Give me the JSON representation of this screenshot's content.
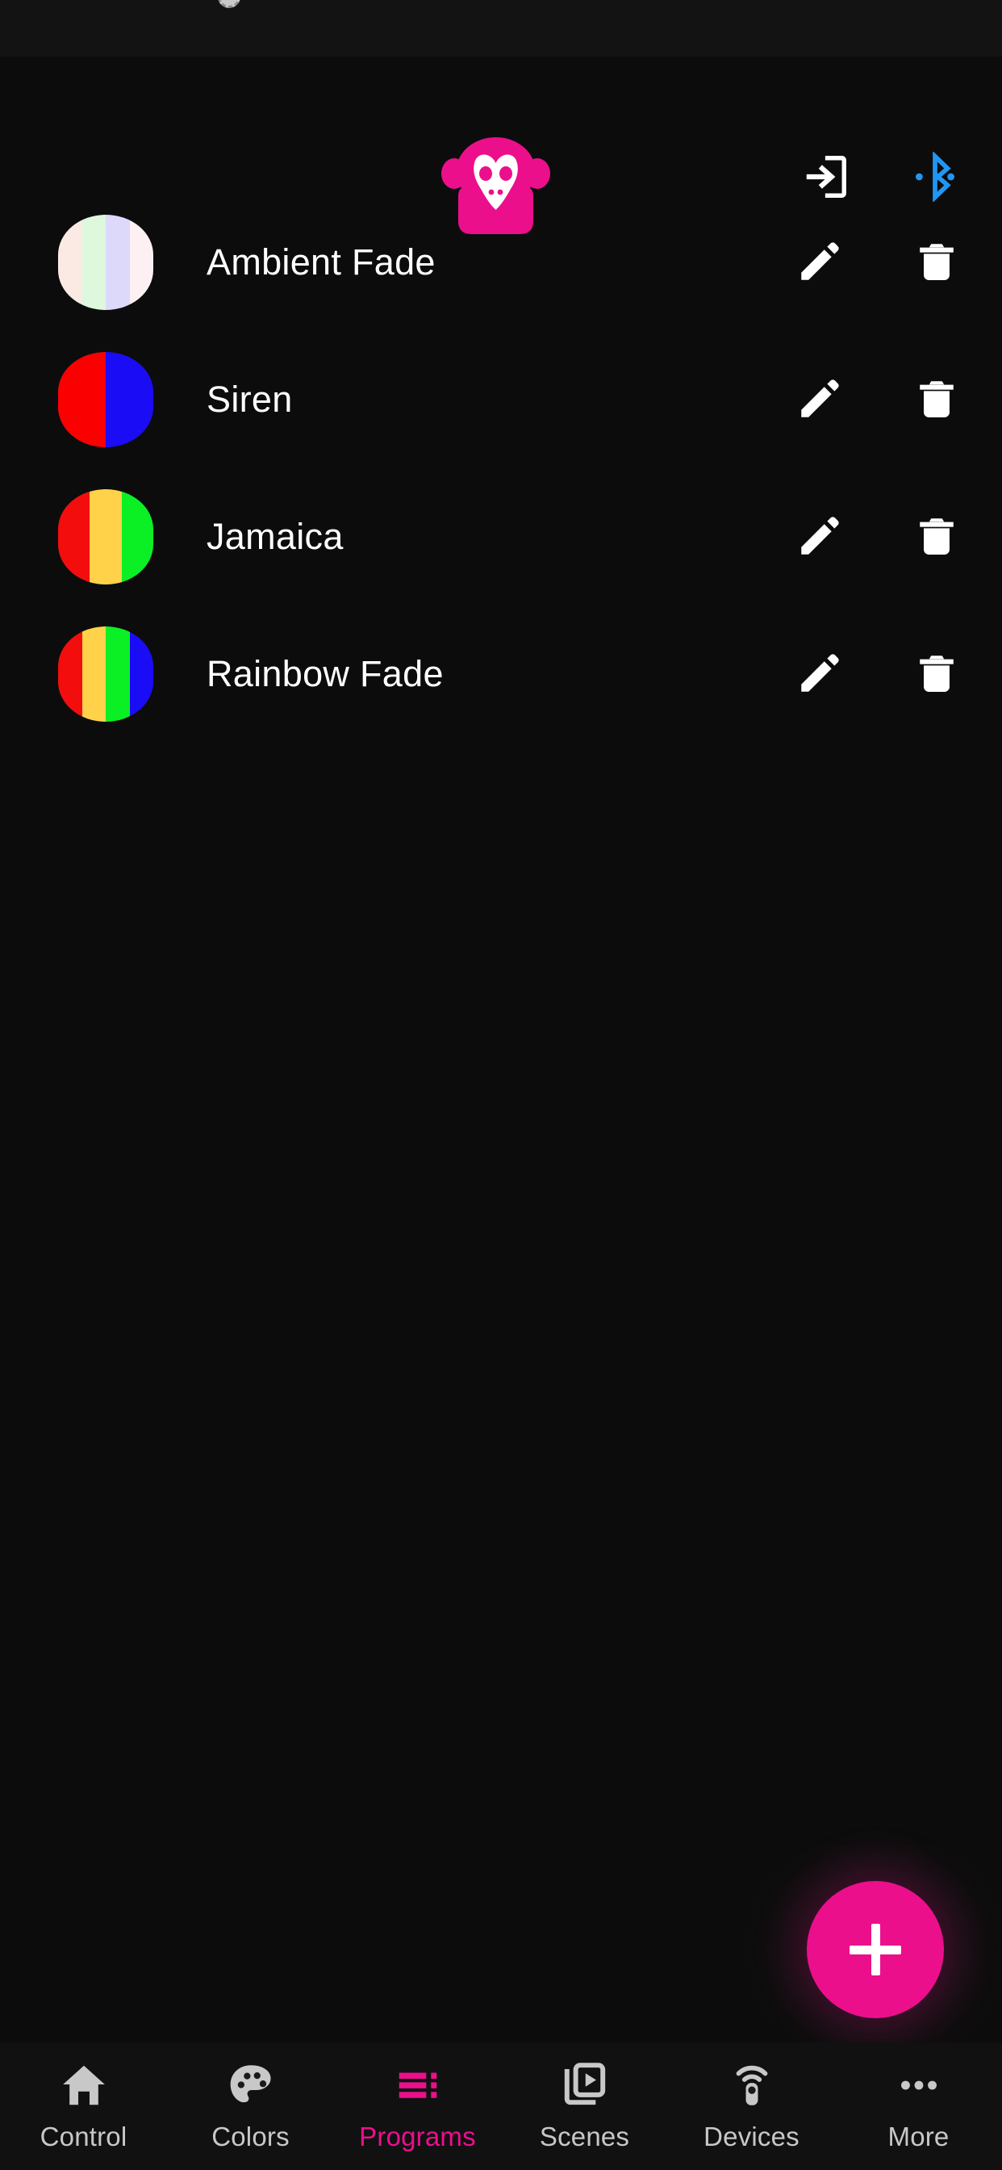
{
  "app": {
    "background": "#0c0c0c",
    "accent": "#ec0f8c",
    "bluetooth_color": "#2196f3",
    "logo_name": "monkey-logo"
  },
  "header": {
    "logo_icon": "monkey-logo-icon",
    "actions": [
      {
        "name": "login-icon",
        "label": "Login"
      },
      {
        "name": "bluetooth-icon",
        "label": "Bluetooth",
        "color": "#2196f3"
      }
    ]
  },
  "programs": [
    {
      "name": "Ambient Fade",
      "swatch_colors": [
        "#fbeae4",
        "#ddf8dd",
        "#dcd9fb",
        "#fdf0f3"
      ],
      "edit_label": "Edit",
      "delete_label": "Delete"
    },
    {
      "name": "Siren",
      "swatch_colors": [
        "#fa0000",
        "#1a0cf5"
      ],
      "edit_label": "Edit",
      "delete_label": "Delete"
    },
    {
      "name": "Jamaica",
      "swatch_colors": [
        "#f40d0d",
        "#ffd24a",
        "#0bf024"
      ],
      "edit_label": "Edit",
      "delete_label": "Delete"
    },
    {
      "name": "Rainbow Fade",
      "swatch_colors": [
        "#f40d0d",
        "#ffd24a",
        "#0bf024",
        "#1a0cf5"
      ],
      "edit_label": "Edit",
      "delete_label": "Delete"
    }
  ],
  "fab": {
    "label": "+",
    "name": "add-program-button",
    "color": "#ec0f8c"
  },
  "bottom_nav": {
    "active": "Programs",
    "items": [
      {
        "label": "Control",
        "icon": "home-icon"
      },
      {
        "label": "Colors",
        "icon": "palette-icon"
      },
      {
        "label": "Programs",
        "icon": "list-icon"
      },
      {
        "label": "Scenes",
        "icon": "video-library-icon"
      },
      {
        "label": "Devices",
        "icon": "remote-control-icon"
      },
      {
        "label": "More",
        "icon": "ellipsis-icon"
      }
    ]
  }
}
